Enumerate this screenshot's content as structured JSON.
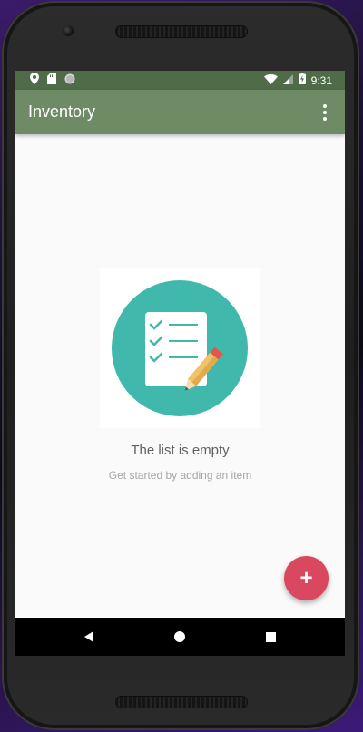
{
  "status_bar": {
    "time": "9:31",
    "left_icons": [
      "location-icon",
      "sd-card-icon",
      "sync-circle-icon"
    ],
    "right_icons": [
      "wifi-icon",
      "signal-icon",
      "battery-icon"
    ]
  },
  "app_bar": {
    "title": "Inventory",
    "overflow_icon": "more-vert-icon"
  },
  "empty_state": {
    "illustration": "checklist-with-pencil-icon",
    "title": "The list is empty",
    "subtitle": "Get started by adding an item"
  },
  "fab": {
    "label": "+",
    "color": "#d9485f"
  },
  "nav_bar": {
    "icons": [
      "back-icon",
      "home-icon",
      "recents-icon"
    ]
  },
  "colors": {
    "status_bar": "#4f6b48",
    "app_bar": "#6e8b66",
    "illustration_circle": "#41b8ac",
    "background": "#fafafa"
  }
}
